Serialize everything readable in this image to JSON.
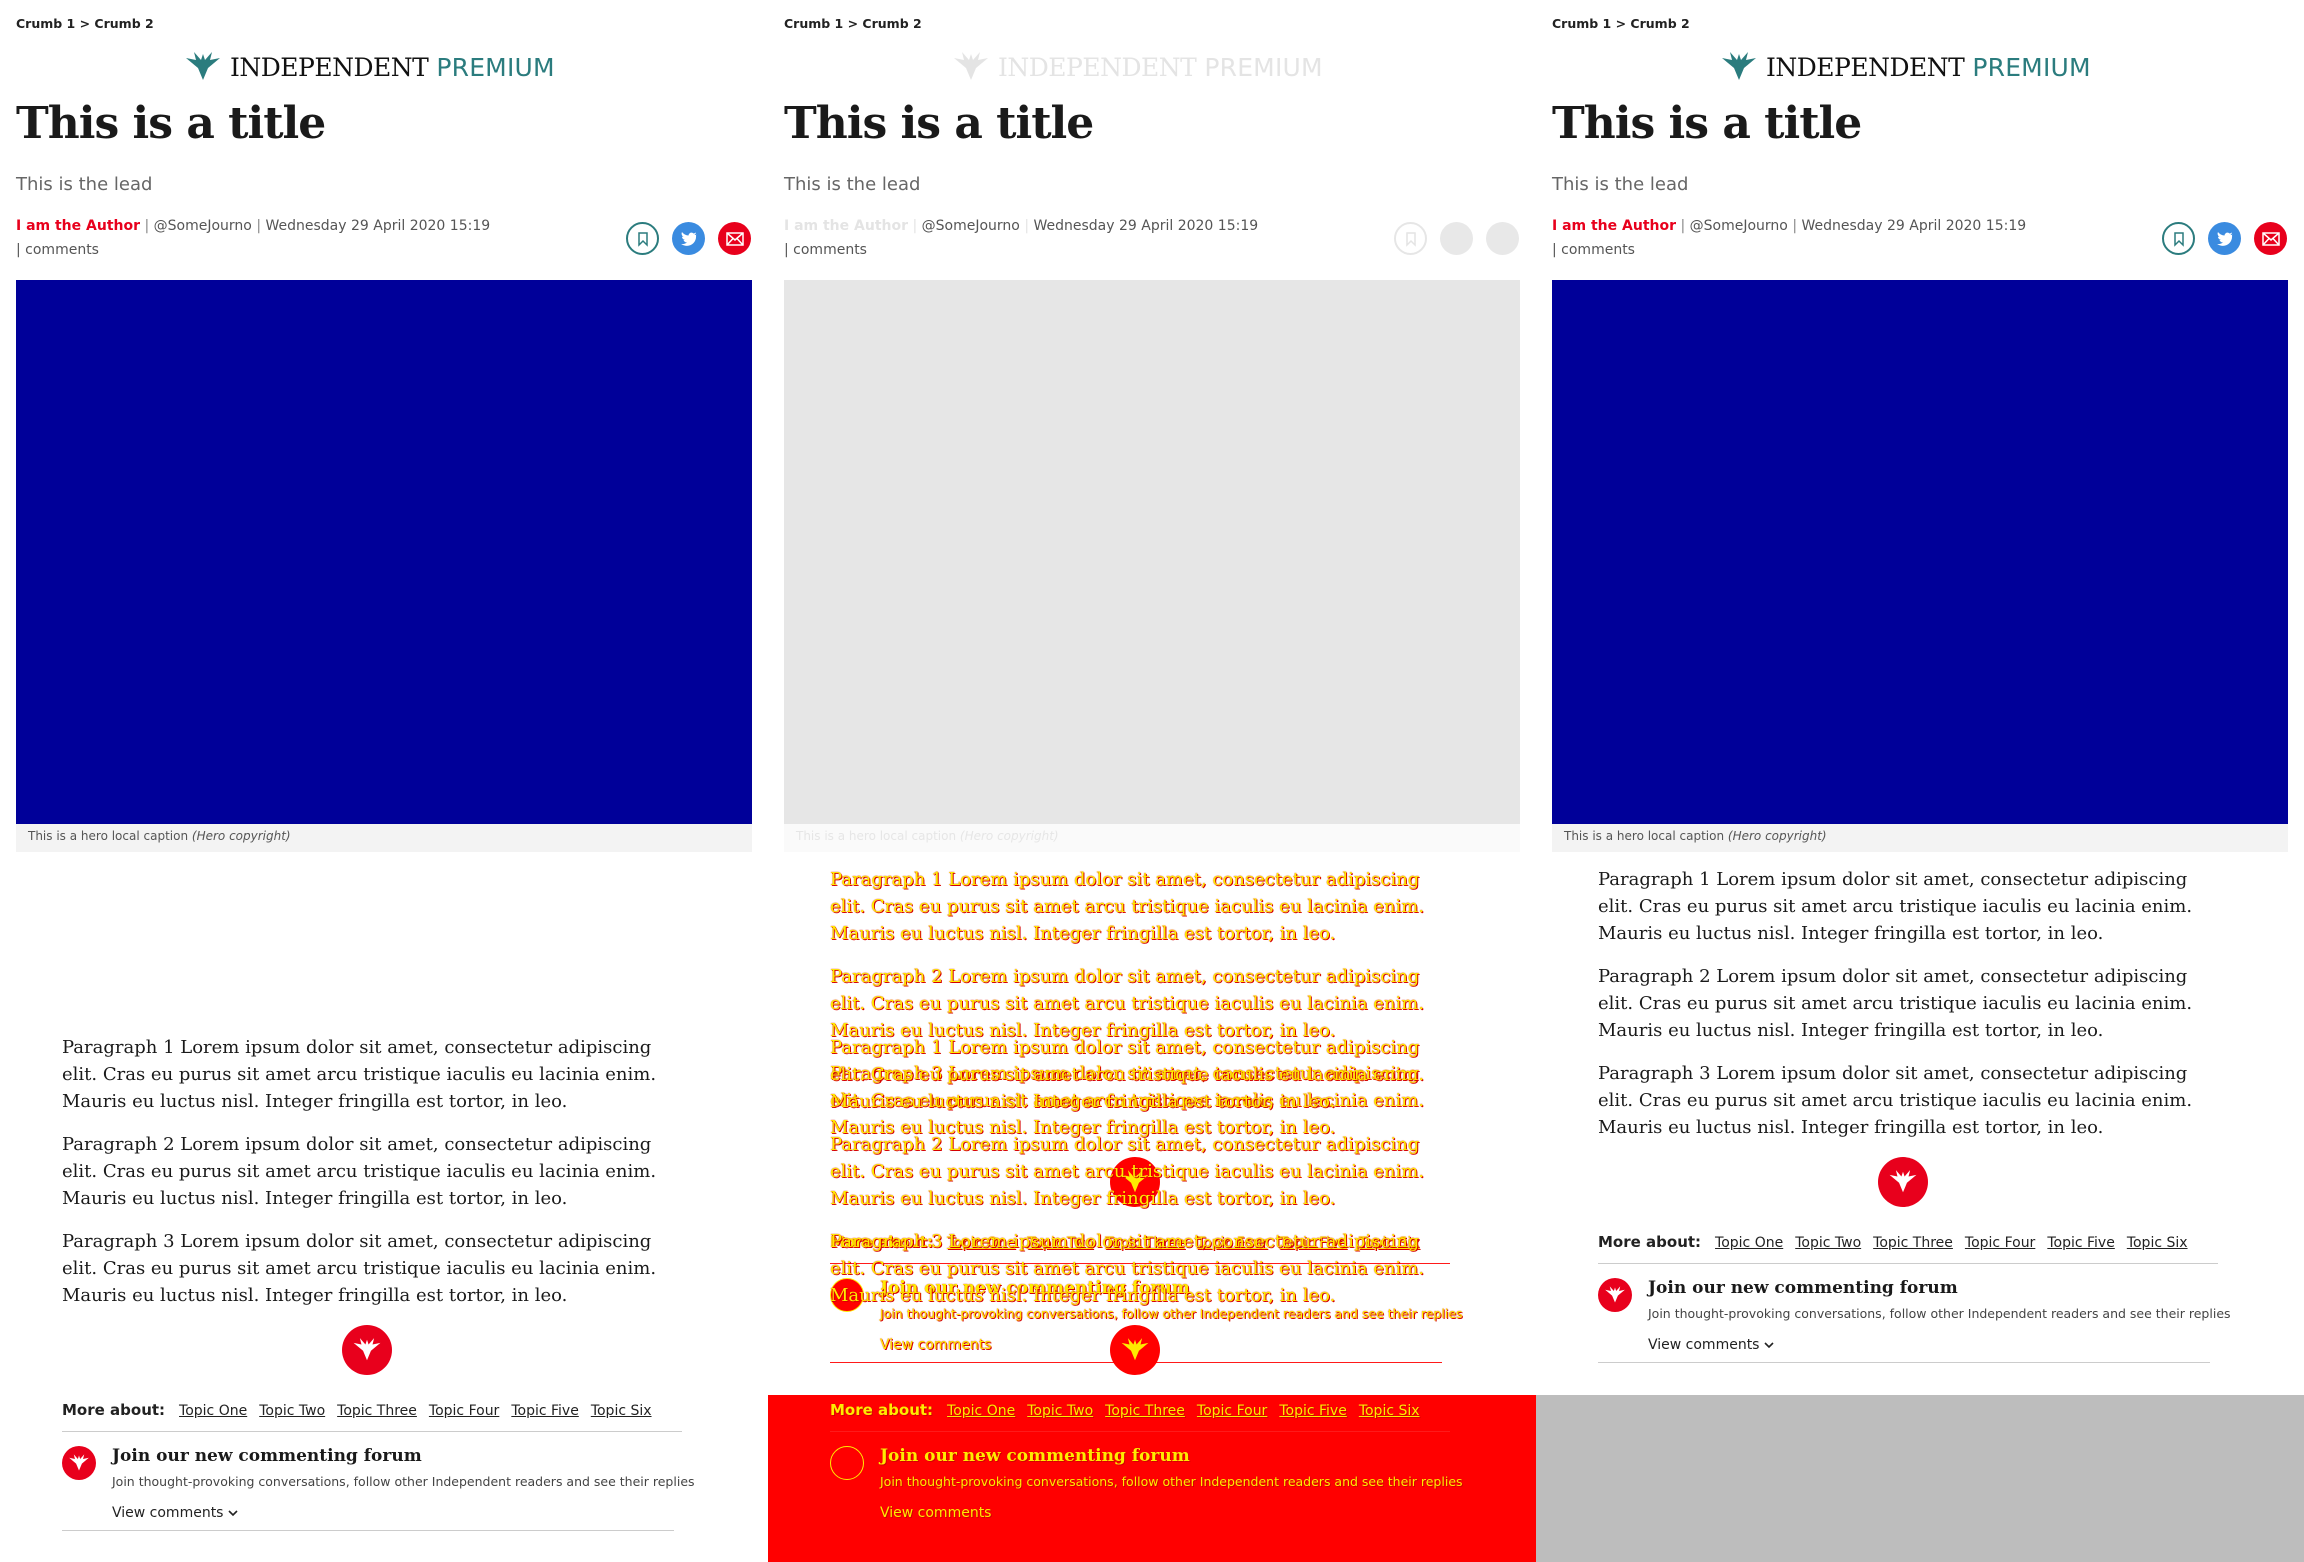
{
  "breadcrumb": "Crumb 1 > Crumb 2",
  "logo": {
    "word": "INDEPENDENT",
    "premium": "PREMIUM"
  },
  "article": {
    "title": "This is a title",
    "lead": "This is the lead",
    "author": "I am the Author",
    "handle": "@SomeJourno",
    "date": "Wednesday 29 April 2020 15:19",
    "comments_label": "comments",
    "hero_caption": "This is a hero local caption",
    "hero_copyright": "(Hero copyright)"
  },
  "paragraphs": [
    "Paragraph 1 Lorem ipsum dolor sit amet, consectetur adipiscing elit. Cras eu purus sit amet arcu tristique iaculis eu lacinia enim. Mauris eu luctus nisl. Integer fringilla est tortor, in leo.",
    "Paragraph 2 Lorem ipsum dolor sit amet, consectetur adipiscing elit. Cras eu purus sit amet arcu tristique iaculis eu lacinia enim. Mauris eu luctus nisl. Integer fringilla est tortor, in leo.",
    "Paragraph 3 Lorem ipsum dolor sit amet, consectetur adipiscing elit. Cras eu purus sit amet arcu tristique iaculis eu lacinia enim. Mauris eu luctus nisl. Integer fringilla est tortor, in leo."
  ],
  "more_about": {
    "label": "More about:",
    "topics": [
      "Topic One",
      "Topic Two",
      "Topic Three",
      "Topic Four",
      "Topic Five",
      "Topic Six"
    ]
  },
  "forum": {
    "title": "Join our new commenting forum",
    "subtitle": "Join thought-provoking conversations, follow other Independent readers and see their replies",
    "view_label": "View comments"
  },
  "colors": {
    "hero": "#000099",
    "brand_red": "#e8001c",
    "premium_teal": "#2b7c7e",
    "twitter_blue": "#3a8be0",
    "diff_red": "#ff0000",
    "diff_yellow": "#ffeb00",
    "gray_bg": "#bdbdbd"
  },
  "icons": [
    "eagle-icon",
    "bookmark-icon",
    "twitter-icon",
    "email-icon",
    "chevron-down-icon"
  ]
}
